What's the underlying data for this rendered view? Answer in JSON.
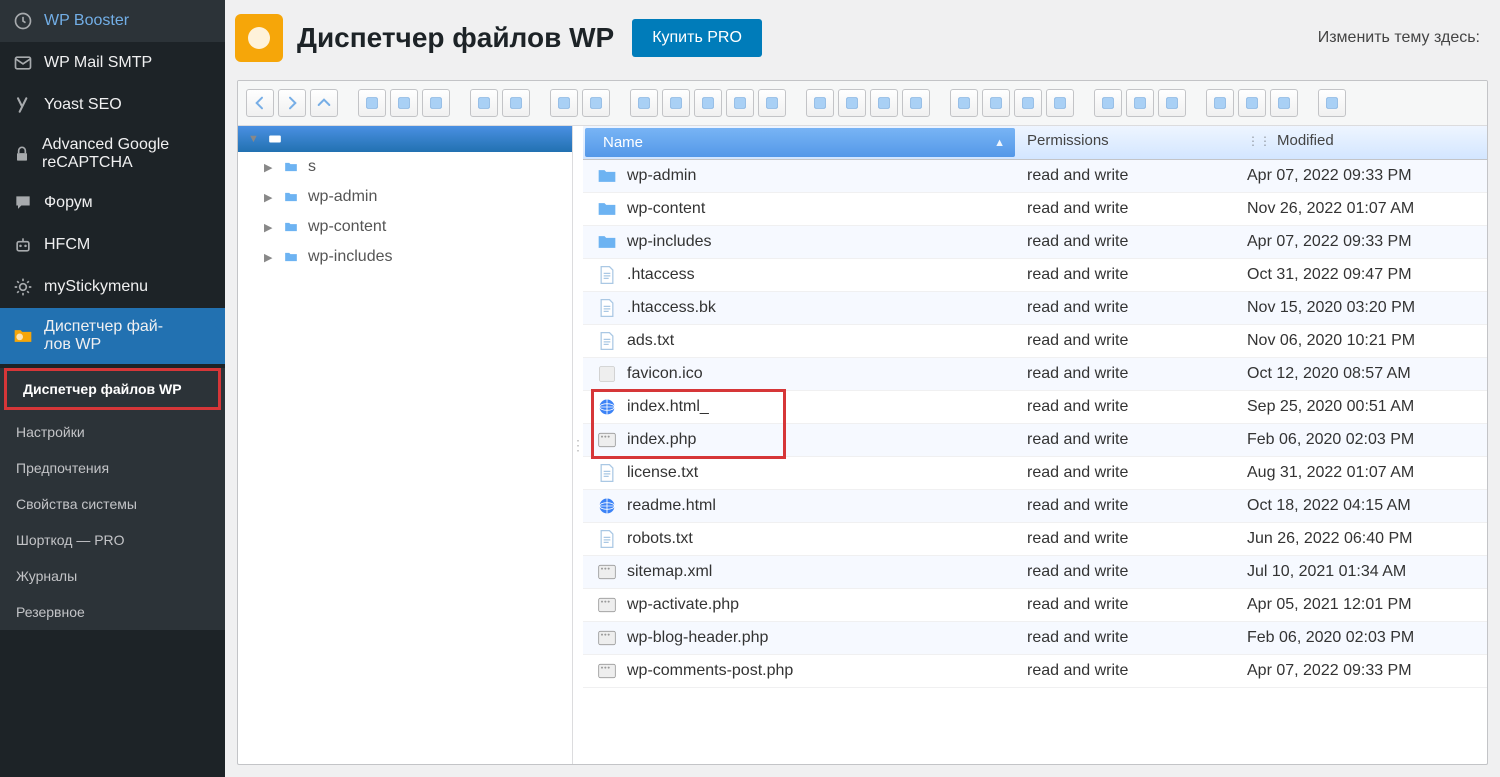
{
  "wp_menu": {
    "items": [
      {
        "label": "WP Booster",
        "icon": "clock"
      },
      {
        "label": "WP Mail SMTP",
        "icon": "mail"
      },
      {
        "label": "Yoast SEO",
        "icon": "yoast"
      },
      {
        "label": "Advanced Google reCAPTCHA",
        "icon": "lock"
      },
      {
        "label": "Форум",
        "icon": "comments"
      },
      {
        "label": "HFCM",
        "icon": "robot"
      },
      {
        "label": "myStickymenu",
        "icon": "gear"
      },
      {
        "label": "Диспетчер фай-\nлов WP",
        "icon": "folder",
        "active": true
      }
    ],
    "submenu": [
      {
        "label": "Диспетчер файлов WP",
        "highlighted": true
      },
      {
        "label": "Настройки"
      },
      {
        "label": "Предпочтения"
      },
      {
        "label": "Свойства системы"
      },
      {
        "label": "Шорткод — PRO"
      },
      {
        "label": "Журналы"
      },
      {
        "label": "Резервное"
      }
    ]
  },
  "header": {
    "title": "Диспетчер файлов WP",
    "buy_pro": "Купить PRO",
    "theme_change": "Изменить тему здесь:"
  },
  "toolbar_groups": [
    [
      "back",
      "forward",
      "up"
    ],
    [
      "new-folder",
      "new-file",
      "save"
    ],
    [
      "copy-alt",
      "paste-alt"
    ],
    [
      "undo",
      "redo"
    ],
    [
      "copy",
      "cut",
      "paste",
      "delete",
      "clear"
    ],
    [
      "rename",
      "select-all",
      "invert",
      "deselect"
    ],
    [
      "icons-large",
      "icons-small",
      "list",
      "columns"
    ],
    [
      "preview",
      "info",
      "sort"
    ],
    [
      "terminal",
      "grid",
      "help"
    ],
    [
      "fullscreen"
    ]
  ],
  "tree": {
    "root_label": "",
    "folders": [
      {
        "name": "s"
      },
      {
        "name": "wp-admin"
      },
      {
        "name": "wp-content"
      },
      {
        "name": "wp-includes"
      }
    ]
  },
  "file_table": {
    "columns": {
      "name": "Name",
      "permissions": "Permissions",
      "modified": "Modified"
    },
    "rows": [
      {
        "name": "wp-admin",
        "type": "folder",
        "perm": "read and write",
        "mod": "Apr 07, 2022 09:33 PM"
      },
      {
        "name": "wp-content",
        "type": "folder",
        "perm": "read and write",
        "mod": "Nov 26, 2022 01:07 AM"
      },
      {
        "name": "wp-includes",
        "type": "folder",
        "perm": "read and write",
        "mod": "Apr 07, 2022 09:33 PM"
      },
      {
        "name": ".htaccess",
        "type": "doc",
        "perm": "read and write",
        "mod": "Oct 31, 2022 09:47 PM"
      },
      {
        "name": ".htaccess.bk",
        "type": "doc",
        "perm": "read and write",
        "mod": "Nov 15, 2020 03:20 PM"
      },
      {
        "name": "ads.txt",
        "type": "doc",
        "perm": "read and write",
        "mod": "Nov 06, 2020 10:21 PM"
      },
      {
        "name": "favicon.ico",
        "type": "fav",
        "perm": "read and write",
        "mod": "Oct 12, 2020 08:57 AM"
      },
      {
        "name": "index.html_",
        "type": "globe",
        "perm": "read and write",
        "mod": "Sep 25, 2020 00:51 AM",
        "highlight": true
      },
      {
        "name": "index.php",
        "type": "php",
        "perm": "read and write",
        "mod": "Feb 06, 2020 02:03 PM",
        "highlight": true
      },
      {
        "name": "license.txt",
        "type": "doc",
        "perm": "read and write",
        "mod": "Aug 31, 2022 01:07 AM"
      },
      {
        "name": "readme.html",
        "type": "globe",
        "perm": "read and write",
        "mod": "Oct 18, 2022 04:15 AM"
      },
      {
        "name": "robots.txt",
        "type": "doc",
        "perm": "read and write",
        "mod": "Jun 26, 2022 06:40 PM"
      },
      {
        "name": "sitemap.xml",
        "type": "php",
        "perm": "read and write",
        "mod": "Jul 10, 2021 01:34 AM"
      },
      {
        "name": "wp-activate.php",
        "type": "php",
        "perm": "read and write",
        "mod": "Apr 05, 2021 12:01 PM"
      },
      {
        "name": "wp-blog-header.php",
        "type": "php",
        "perm": "read and write",
        "mod": "Feb 06, 2020 02:03 PM"
      },
      {
        "name": "wp-comments-post.php",
        "type": "php",
        "perm": "read and write",
        "mod": "Apr 07, 2022 09:33 PM"
      }
    ]
  }
}
